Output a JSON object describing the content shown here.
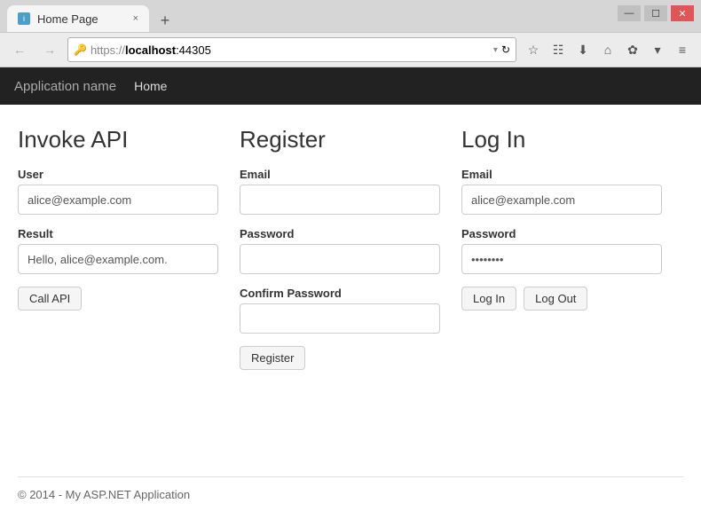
{
  "browser": {
    "tab": {
      "label": "Home Page",
      "close": "×",
      "new_tab": "+"
    },
    "window_controls": {
      "minimize": "—",
      "maximize": "☐",
      "close": "✕"
    },
    "address": {
      "protocol": "https://",
      "host": "localhost",
      "port": ":44305"
    },
    "toolbar_icons": [
      "☆",
      "☷",
      "⬇",
      "⌂",
      "✿",
      "▾",
      "≡"
    ]
  },
  "navbar": {
    "app_name": "Application name",
    "links": [
      "Home"
    ]
  },
  "invoke_api": {
    "title": "Invoke API",
    "user_label": "User",
    "user_value": "alice@example.com",
    "result_label": "Result",
    "result_value": "Hello, alice@example.com.",
    "call_button": "Call API"
  },
  "register": {
    "title": "Register",
    "email_label": "Email",
    "email_placeholder": "",
    "password_label": "Password",
    "password_placeholder": "",
    "confirm_label": "Confirm Password",
    "confirm_placeholder": "",
    "register_button": "Register"
  },
  "login": {
    "title": "Log In",
    "email_label": "Email",
    "email_value": "alice@example.com",
    "password_label": "Password",
    "password_value": "••••••••",
    "login_button": "Log In",
    "logout_button": "Log Out"
  },
  "footer": {
    "text": "© 2014 - My ASP.NET Application"
  }
}
